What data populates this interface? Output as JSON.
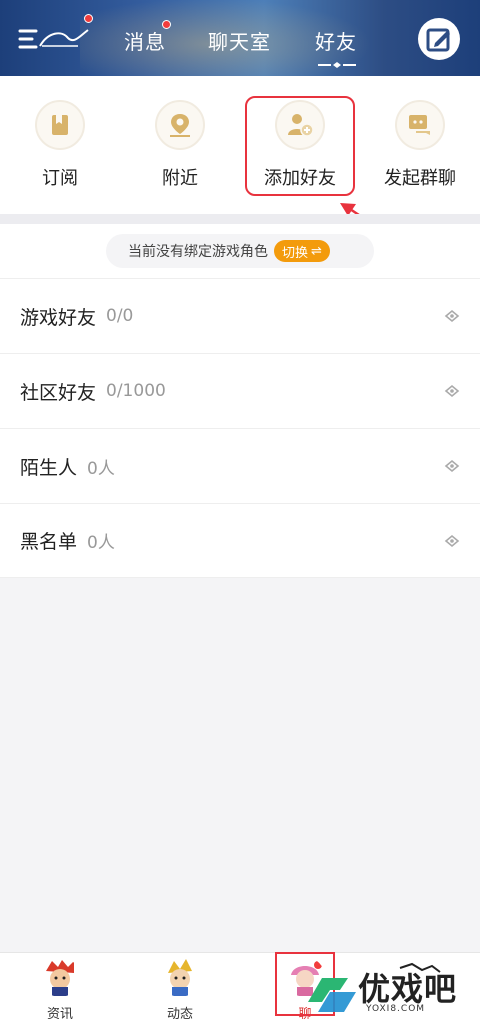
{
  "header": {
    "tabs": [
      {
        "label": "消息",
        "has_dot": true
      },
      {
        "label": "聊天室",
        "has_dot": false
      },
      {
        "label": "好友",
        "active": true
      }
    ],
    "logo_icon": "menu-logo-icon",
    "edit_icon": "edit-icon"
  },
  "actions": [
    {
      "label": "订阅",
      "icon": "bookmark-icon"
    },
    {
      "label": "附近",
      "icon": "location-pin-icon"
    },
    {
      "label": "添加好友",
      "icon": "add-friend-icon",
      "highlighted": true
    },
    {
      "label": "发起群聊",
      "icon": "group-chat-icon"
    }
  ],
  "banner": {
    "text": "当前没有绑定游戏角色",
    "switch_label": "切换",
    "switch_icon": "⇌"
  },
  "groups": [
    {
      "name": "游戏好友",
      "count": "0/0"
    },
    {
      "name": "社区好友",
      "count": "0/1000"
    },
    {
      "name": "陌生人",
      "count": "0人"
    },
    {
      "name": "黑名单",
      "count": "0人"
    }
  ],
  "bottom_nav": [
    {
      "label": "资讯"
    },
    {
      "label": "动态"
    },
    {
      "label": "聊",
      "active": true
    }
  ],
  "watermark": {
    "text": "优戏吧",
    "url": "YOXI8.COM"
  },
  "colors": {
    "header": "#2d4d84",
    "highlight": "#e8333e",
    "switch": "#f39b0c",
    "icon_gold": "#d8b36a"
  }
}
